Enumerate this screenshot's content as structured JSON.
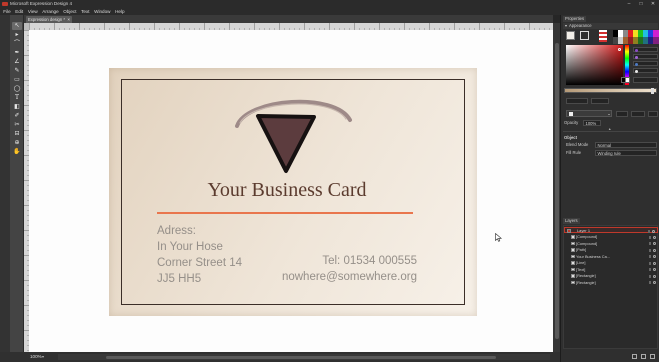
{
  "window": {
    "title": "Microsoft Expression Design 4",
    "controls": [
      "–",
      "□",
      "✕"
    ]
  },
  "menu": [
    "File",
    "Edit",
    "View",
    "Arrange",
    "Object",
    "Text",
    "Window",
    "Help"
  ],
  "document": {
    "tab_label": "Expression design *",
    "tab_close": "×"
  },
  "tools": {
    "icons": [
      "selection-icon",
      "direct-selection-icon",
      "lasso-icon",
      "pen-icon",
      "polyline-icon",
      "paintbrush-icon",
      "rectangle-icon",
      "ellipse-icon",
      "text-icon",
      "gradient-icon",
      "eyedropper-icon",
      "scissors-icon",
      "slice-icon",
      "zoom-icon",
      "pan-icon"
    ],
    "active": "selection-icon"
  },
  "card": {
    "title": "Your Business Card",
    "address_lines": [
      "Adress:",
      "In Your Hose",
      "Corner Street 14",
      "JJ5 HH5"
    ],
    "tel": "Tel: 01534 000555",
    "email": "nowhere@somewhere.org",
    "colors": {
      "card-bg-start": "#e2d2be",
      "card-bg-end": "#f7f1e9",
      "card-title": "#5b3b2e",
      "card-rule": "#e9764d",
      "card-text": "#958f89",
      "logo-fill": "#5c3c3e",
      "logo-stroke": "#161111",
      "logo-arc": "#9e8a88"
    }
  },
  "properties": {
    "tab": "Properties",
    "appearance": "Appearance",
    "opacity_label": "Opacity",
    "opacity_value": "100%",
    "object_header": "Object",
    "blend_mode_label": "Blend Mode",
    "blend_mode_value": "Normal",
    "fill_rule_label": "Fill Rule",
    "fill_rule_value": "Winding rule"
  },
  "layers": {
    "tab": "Layers",
    "items": [
      "Layer 1",
      "[Compound]",
      "[Compound]",
      "[Path]",
      "Your Business Ca...",
      "[Line]",
      "[Text]",
      "[Rectangle]",
      "[Rectangle]"
    ]
  },
  "status": {
    "zoom": "100%",
    "zoom_arrow": "▾"
  },
  "theme": {
    "selection": "#c0392b"
  }
}
